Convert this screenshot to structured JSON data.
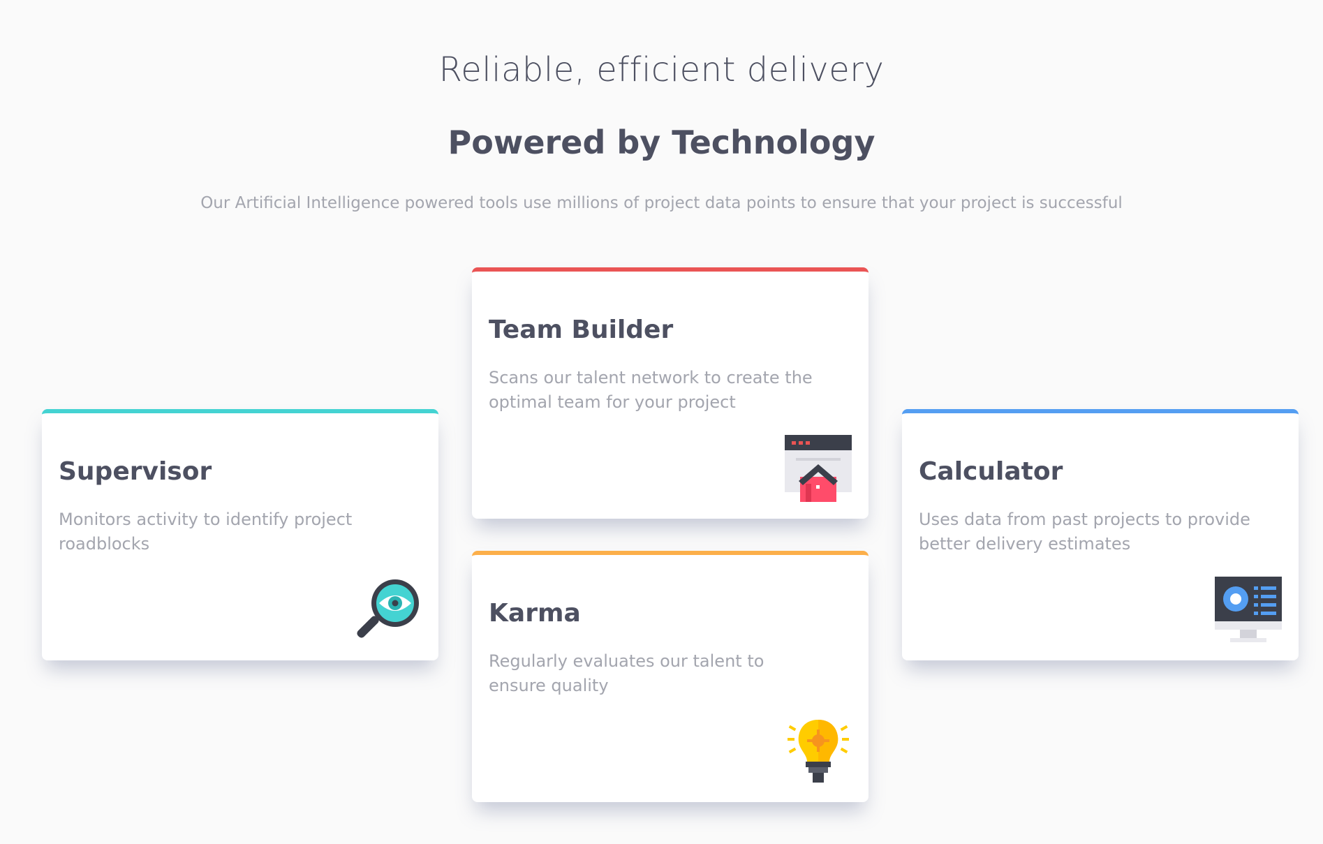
{
  "hero": {
    "subtitle": "Reliable, efficient delivery",
    "title": "Powered by Technology",
    "description": "Our Artificial Intelligence powered tools use millions of project data points to ensure that your project is successful"
  },
  "cards": {
    "supervisor": {
      "title": "Supervisor",
      "description": "Monitors activity to identify project roadblocks",
      "accent": "#44d3d2",
      "icon": "magnifier-eye-icon"
    },
    "team_builder": {
      "title": "Team Builder",
      "description": "Scans our talent network to create the optimal team for your project",
      "accent": "#ea5454",
      "icon": "browser-house-icon"
    },
    "karma": {
      "title": "Karma",
      "description": "Regularly evaluates our talent to ensure quality",
      "accent": "#fcaf4a",
      "icon": "lightbulb-icon"
    },
    "calculator": {
      "title": "Calculator",
      "description": "Uses data from past projects to provide better delivery estimates",
      "accent": "#549ef2",
      "icon": "monitor-chart-icon"
    }
  },
  "colors": {
    "background": "#fafafa",
    "heading": "#4d5061",
    "muted": "#a3a5ae"
  }
}
